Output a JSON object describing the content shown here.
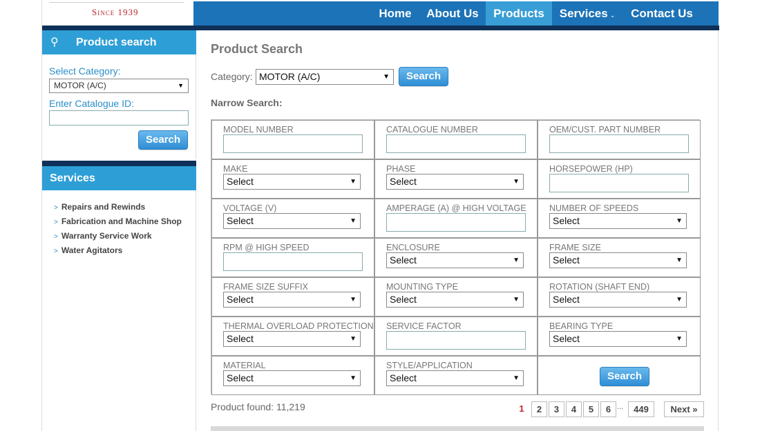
{
  "brand": {
    "since": "Since 1939"
  },
  "nav": {
    "home": "Home",
    "about": "About Us",
    "products": "Products",
    "services": "Services",
    "contact": "Contact Us"
  },
  "sidebar": {
    "product_search_title": "Product search",
    "select_category_label": "Select Category:",
    "category_value": "MOTOR (A/C)",
    "catalogue_id_label": "Enter Catalogue ID:",
    "search_button": "Search",
    "services_title": "Services",
    "services_items": [
      "Repairs and Rewinds",
      "Fabrication and Machine Shop",
      "Warranty Service Work",
      "Water Agitators"
    ]
  },
  "main": {
    "title": "Product Search",
    "category_label": "Category:",
    "category_value": "MOTOR (A/C)",
    "search_button": "Search",
    "narrow_label": "Narrow Search:",
    "fields": [
      {
        "label": "MODEL NUMBER",
        "type": "input"
      },
      {
        "label": "CATALOGUE NUMBER",
        "type": "input"
      },
      {
        "label": "OEM/CUST. PART NUMBER",
        "type": "input"
      },
      {
        "label": "MAKE",
        "type": "select",
        "value": "Select"
      },
      {
        "label": "PHASE",
        "type": "select",
        "value": "Select"
      },
      {
        "label": "HORSEPOWER (HP)",
        "type": "input"
      },
      {
        "label": "VOLTAGE (V)",
        "type": "select",
        "value": "Select"
      },
      {
        "label": "AMPERAGE (A) @ HIGH VOLTAGE",
        "type": "input"
      },
      {
        "label": "NUMBER OF SPEEDS",
        "type": "select",
        "value": "Select"
      },
      {
        "label": "RPM @ HIGH SPEED",
        "type": "input"
      },
      {
        "label": "ENCLOSURE",
        "type": "select",
        "value": "Select"
      },
      {
        "label": "FRAME SIZE",
        "type": "select",
        "value": "Select"
      },
      {
        "label": "FRAME SIZE SUFFIX",
        "type": "select",
        "value": "Select"
      },
      {
        "label": "MOUNTING TYPE",
        "type": "select",
        "value": "Select"
      },
      {
        "label": "ROTATION (SHAFT END)",
        "type": "select",
        "value": "Select"
      },
      {
        "label": "THERMAL OVERLOAD PROTECTION",
        "type": "select",
        "value": "Select"
      },
      {
        "label": "SERVICE FACTOR",
        "type": "input"
      },
      {
        "label": "BEARING TYPE",
        "type": "select",
        "value": "Select"
      },
      {
        "label": "MATERIAL",
        "type": "select",
        "value": "Select"
      },
      {
        "label": "STYLE/APPLICATION",
        "type": "select",
        "value": "Select"
      }
    ],
    "grid_search_button": "Search",
    "products_found": "Product found: 11,219",
    "pagination": {
      "pages": [
        "1",
        "2",
        "3",
        "4",
        "5",
        "6"
      ],
      "current": "1",
      "ellipsis": "...",
      "last": "449",
      "next": "Next »"
    }
  },
  "colors": {
    "nav_blue": "#1c73b8",
    "nav_active": "#3a9ed6",
    "dark_navy": "#0f3058",
    "accent_red": "#c0262d"
  }
}
